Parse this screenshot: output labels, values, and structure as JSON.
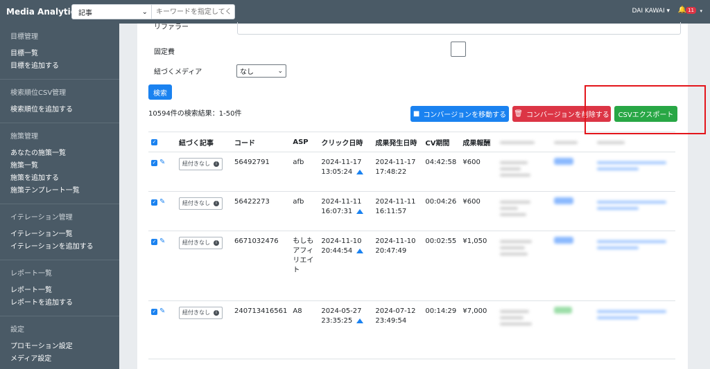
{
  "app": {
    "title": "Media Analytics"
  },
  "search": {
    "select_value": "記事",
    "placeholder": "キーワードを指定してく"
  },
  "user": {
    "name": "DAI KAWAI",
    "notifications": "11"
  },
  "sidebar": {
    "sections": [
      {
        "title": "目標管理",
        "items": [
          "目標一覧",
          "目標を追加する"
        ]
      },
      {
        "title": "検索順位CSV管理",
        "items": [
          "検索順位を追加する"
        ]
      },
      {
        "title": "施策管理",
        "items": [
          "あなたの施策一覧",
          "施策一覧",
          "施策を追加する",
          "施策テンプレート一覧"
        ]
      },
      {
        "title": "イテレーション管理",
        "items": [
          "イテレーション一覧",
          "イテレーションを追加する"
        ]
      },
      {
        "title": "レポート一覧",
        "items": [
          "レポート一覧",
          "レポートを追加する"
        ]
      },
      {
        "title": "設定",
        "items": [
          "プロモーション設定",
          "メディア設定"
        ]
      }
    ]
  },
  "form": {
    "referrer_label": "リファラー",
    "fixed_cost_label": "固定費",
    "media_label": "紐づくメディア",
    "media_value": "なし",
    "search_button": "検索"
  },
  "results": {
    "summary": "10594件の検索結果：1-50件"
  },
  "actions": {
    "move": "コンバージョンを移動する",
    "delete": "コンバージョンを削除する",
    "csv": "CSVエクスポート"
  },
  "table": {
    "headers": [
      "紐づく記事",
      "コード",
      "ASP",
      "クリック日時",
      "成果発生日時",
      "CV期間",
      "成果報酬"
    ],
    "link_label": "紐付きなし",
    "rows": [
      {
        "code": "56492791",
        "asp": "afb",
        "click_date": "2024-11-17",
        "click_time": "13:05:24",
        "cv_date": "2024-11-17",
        "cv_time": "17:48:22",
        "period": "04:42:58",
        "reward": "¥600"
      },
      {
        "code": "56422273",
        "asp": "afb",
        "click_date": "2024-11-11",
        "click_time": "16:07:31",
        "cv_date": "2024-11-11",
        "cv_time": "16:11:57",
        "period": "00:04:26",
        "reward": "¥600"
      },
      {
        "code": "6671032476",
        "asp": "もしもアフィリエイト",
        "click_date": "2024-11-10",
        "click_time": "20:44:54",
        "cv_date": "2024-11-10",
        "cv_time": "20:47:49",
        "period": "00:02:55",
        "reward": "¥1,050"
      },
      {
        "code": "240713416561",
        "asp": "A8",
        "click_date": "2024-05-27",
        "click_time": "23:35:25",
        "cv_date": "2024-07-12",
        "cv_time": "23:49:54",
        "period": "00:14:29",
        "reward": "¥7,000"
      }
    ]
  },
  "colors": {
    "primary": "#1a82f0",
    "danger": "#dc3545",
    "success": "#28a745",
    "sidebar": "#4a5a66",
    "highlight": "#e3141a"
  }
}
